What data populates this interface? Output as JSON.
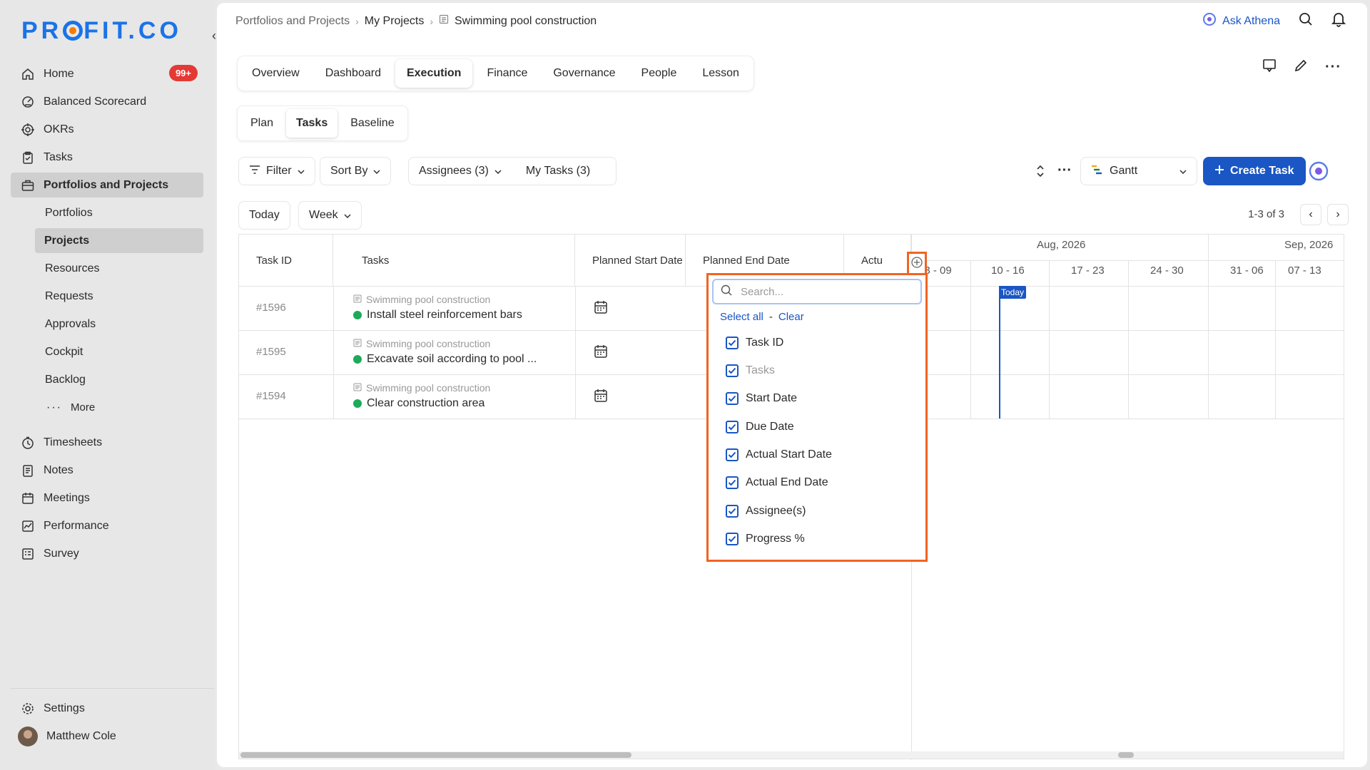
{
  "brand": {
    "logo_text_before": "PR",
    "logo_text_after": "FIT.CO",
    "accent": "#1a73e8",
    "dot": "#f57c00"
  },
  "sidebar": {
    "items": [
      {
        "label": "Home",
        "icon": "home-icon",
        "badge": "99+"
      },
      {
        "label": "Balanced Scorecard",
        "icon": "scorecard-icon"
      },
      {
        "label": "OKRs",
        "icon": "target-icon"
      },
      {
        "label": "Tasks",
        "icon": "clipboard-icon"
      },
      {
        "label": "Portfolios and Projects",
        "icon": "briefcase-icon"
      }
    ],
    "sub_items": [
      {
        "label": "Portfolios"
      },
      {
        "label": "Projects"
      },
      {
        "label": "Resources"
      },
      {
        "label": "Requests"
      },
      {
        "label": "Approvals"
      },
      {
        "label": "Cockpit"
      },
      {
        "label": "Backlog"
      },
      {
        "label": "More"
      }
    ],
    "items2": [
      {
        "label": "Timesheets",
        "icon": "stopwatch-icon"
      },
      {
        "label": "Notes",
        "icon": "notes-icon"
      },
      {
        "label": "Meetings",
        "icon": "calendar-icon"
      },
      {
        "label": "Performance",
        "icon": "chart-icon"
      },
      {
        "label": "Survey",
        "icon": "survey-icon"
      }
    ],
    "settings": "Settings",
    "user": "Matthew Cole"
  },
  "breadcrumb": {
    "level1": "Portfolios and Projects",
    "level2": "My Projects",
    "current": "Swimming pool construction"
  },
  "header": {
    "ask": "Ask Athena"
  },
  "tabs": [
    "Overview",
    "Dashboard",
    "Execution",
    "Finance",
    "Governance",
    "People",
    "Lesson"
  ],
  "subtabs": [
    "Plan",
    "Tasks",
    "Baseline"
  ],
  "toolbar": {
    "filter": "Filter",
    "sort": "Sort By",
    "assignees": "Assignees (3)",
    "mytasks": "My Tasks (3)",
    "view": "Gantt",
    "create": "Create Task"
  },
  "nav": {
    "today": "Today",
    "range": "Week",
    "pager": "1-3 of 3"
  },
  "columns": {
    "id": "Task ID",
    "tasks": "Tasks",
    "pstart": "Planned Start Date",
    "pend": "Planned End Date",
    "actual": "Actu"
  },
  "rows": [
    {
      "id": "#1596",
      "project": "Swimming pool construction",
      "task": "Install steel reinforcement bars"
    },
    {
      "id": "#1595",
      "project": "Swimming pool construction",
      "task": "Excavate soil according to pool ..."
    },
    {
      "id": "#1594",
      "project": "Swimming pool construction",
      "task": "Clear construction area"
    }
  ],
  "gantt": {
    "months": [
      "Aug, 2026",
      "Sep, 2026"
    ],
    "weeks": [
      "03 - 09",
      "10 - 16",
      "17 - 23",
      "24 - 30",
      "31 - 06",
      "07 - 13"
    ],
    "today": "Today"
  },
  "column_picker": {
    "placeholder": "Search...",
    "select_all": "Select all",
    "dash": "-",
    "clear": "Clear",
    "options": [
      {
        "label": "Task ID",
        "checked": true
      },
      {
        "label": "Tasks",
        "checked": true,
        "disabled": true
      },
      {
        "label": "Start Date",
        "checked": true
      },
      {
        "label": "Due Date",
        "checked": true
      },
      {
        "label": "Actual Start Date",
        "checked": true
      },
      {
        "label": "Actual End Date",
        "checked": true
      },
      {
        "label": "Assignee(s)",
        "checked": true
      },
      {
        "label": "Progress %",
        "checked": true
      }
    ]
  },
  "colors": {
    "primary": "#1a56c4",
    "highlight": "#f26322",
    "status_green": "#1faa59",
    "badge_red": "#e53935"
  }
}
